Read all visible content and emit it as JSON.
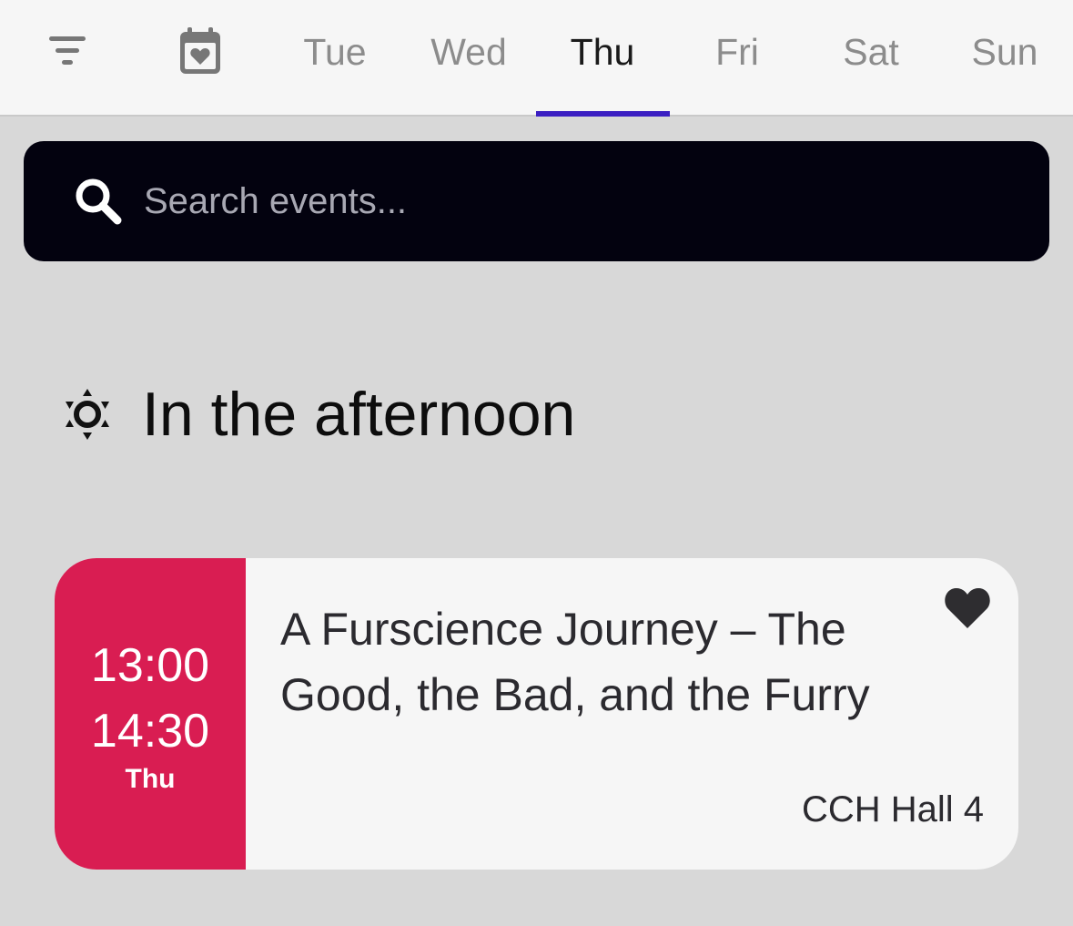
{
  "toolbar": {
    "filter_icon": "filter-icon",
    "favorites_calendar_icon": "calendar-heart-icon"
  },
  "day_tabs": [
    {
      "label": "Tue"
    },
    {
      "label": "Wed"
    },
    {
      "label": "Thu",
      "active": true
    },
    {
      "label": "Fri"
    },
    {
      "label": "Sat"
    },
    {
      "label": "Sun"
    }
  ],
  "search": {
    "placeholder": "Search events...",
    "value": ""
  },
  "section": {
    "icon": "sun-icon",
    "title": "In the afternoon"
  },
  "event": {
    "start_time": "13:00",
    "end_time": "14:30",
    "day": "Thu",
    "title": "A Furscience Journey – The Good, the Bad, and the Furry",
    "location": "CCH Hall 4",
    "favorited": true
  },
  "colors": {
    "accent": "#3b1fc2",
    "event_time_block": "#d91d52",
    "search_bg": "#03020f",
    "page_bg": "#d8d8d8"
  }
}
